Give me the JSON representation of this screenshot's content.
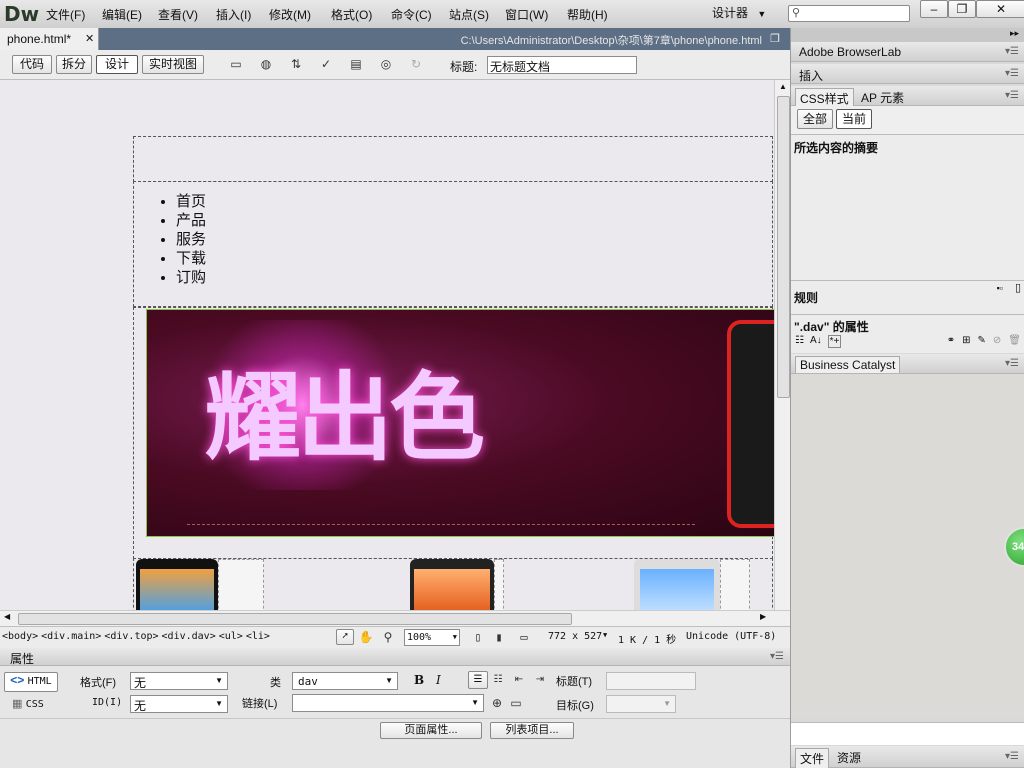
{
  "app": {
    "logo": "Dw",
    "menu": [
      "文件(F)",
      "编辑(E)",
      "查看(V)",
      "插入(I)",
      "修改(M)",
      "格式(O)",
      "命令(C)",
      "站点(S)",
      "窗口(W)",
      "帮助(H)"
    ],
    "workspace": "设计器",
    "search_placeholder": ""
  },
  "document": {
    "tab_name": "phone.html*",
    "path": "C:\\Users\\Administrator\\Desktop\\杂项\\第7章\\phone\\phone.html",
    "view_buttons": [
      "代码",
      "拆分",
      "设计",
      "实时视图"
    ],
    "active_view": "设计",
    "title_label": "标题:",
    "title_value": "无标题文档"
  },
  "design": {
    "nav_items": [
      "首页",
      "产品",
      "服务",
      "下载",
      "订购"
    ],
    "banner_text": "耀出色"
  },
  "status": {
    "tag_path": [
      "<body>",
      "<div.main>",
      "<div.top>",
      "<div.dav>",
      "<ul>",
      "<li>"
    ],
    "zoom": "100%",
    "dimensions": "772 x 527",
    "size_time": "1 K / 1 秒",
    "encoding": "Unicode (UTF-8)"
  },
  "properties": {
    "panel_title": "属性",
    "html_tab": "HTML",
    "css_tab": "CSS",
    "format_label": "格式(F)",
    "format_value": "无",
    "class_label": "类",
    "class_value": "dav",
    "id_label": "ID(I)",
    "id_value": "无",
    "link_label": "链接(L)",
    "link_value": "",
    "title_label": "标题(T)",
    "target_label": "目标(G)",
    "bold": "B",
    "italic": "I",
    "page_props_btn": "页面属性...",
    "list_item_btn": "列表项目..."
  },
  "right_panels": {
    "browserlab": "Adobe BrowserLab",
    "insert": "插入",
    "css_tab": "CSS样式",
    "ap_tab": "AP 元素",
    "all": "全部",
    "current": "当前",
    "summary_title": "所选内容的摘要",
    "rules_label": "规则",
    "props_for": "\".dav\" 的属性",
    "business_catalyst": "Business Catalyst",
    "files_tab": "文件",
    "assets_tab": "资源"
  },
  "floating_badge": "34"
}
